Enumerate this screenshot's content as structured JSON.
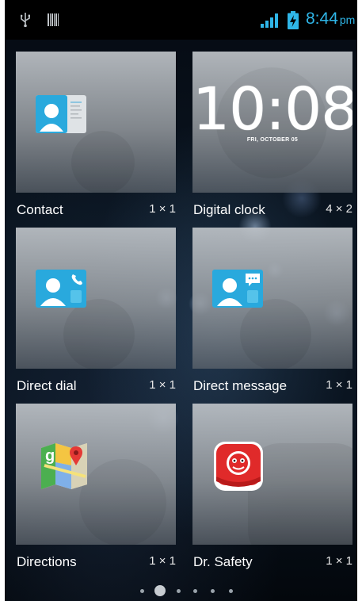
{
  "status_bar": {
    "time": "8:44",
    "ampm": "pm",
    "icons": [
      "usb-icon",
      "barcode-icon",
      "signal-icon",
      "battery-charging-icon"
    ],
    "accent_color": "#2fb6e8"
  },
  "widgets": [
    {
      "name": "Contact",
      "size": "1 × 1",
      "icon": "contact-card-icon"
    },
    {
      "name": "Digital clock",
      "size": "4 × 2",
      "preview_time": "10:08",
      "preview_date": "FRI, OCTOBER 05"
    },
    {
      "name": "Direct dial",
      "size": "1 × 1",
      "icon": "direct-dial-icon"
    },
    {
      "name": "Direct message",
      "size": "1 × 1",
      "icon": "direct-message-icon"
    },
    {
      "name": "Directions",
      "size": "1 × 1",
      "icon": "maps-directions-icon"
    },
    {
      "name": "Dr. Safety",
      "size": "1 × 1",
      "icon": "dr-safety-icon"
    }
  ],
  "pager": {
    "page_count": 6,
    "current_page": 2
  }
}
